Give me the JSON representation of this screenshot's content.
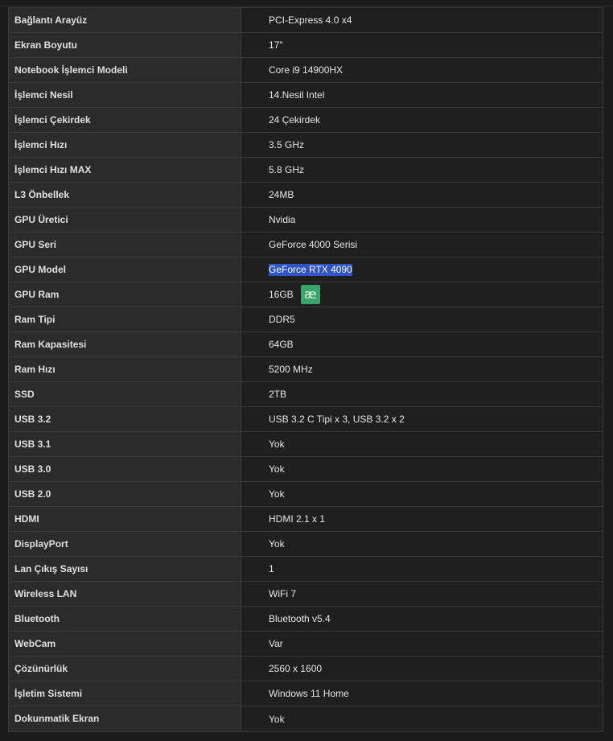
{
  "specs": [
    {
      "label": "Bağlantı Arayüz",
      "value": "PCI-Express 4.0 x4"
    },
    {
      "label": "Ekran Boyutu",
      "value": "17\""
    },
    {
      "label": "Notebook İşlemci Modeli",
      "value": "Core i9 14900HX"
    },
    {
      "label": "İşlemci Nesil",
      "value": "14.Nesil Intel"
    },
    {
      "label": "İşlemci Çekirdek",
      "value": "24 Çekirdek"
    },
    {
      "label": "İşlemci Hızı",
      "value": "3.5 GHz"
    },
    {
      "label": "İşlemci Hızı MAX",
      "value": "5.8 GHz"
    },
    {
      "label": "L3 Önbellek",
      "value": "24MB"
    },
    {
      "label": "GPU Üretici",
      "value": "Nvidia"
    },
    {
      "label": "GPU Seri",
      "value": "GeForce 4000 Serisi"
    },
    {
      "label": "GPU Model",
      "value": "GeForce RTX 4090"
    },
    {
      "label": "GPU Ram",
      "value": "16GB"
    },
    {
      "label": "Ram Tipi",
      "value": "DDR5"
    },
    {
      "label": "Ram Kapasitesi",
      "value": "64GB"
    },
    {
      "label": "Ram Hızı",
      "value": "5200 MHz"
    },
    {
      "label": "SSD",
      "value": "2TB"
    },
    {
      "label": "USB 3.2",
      "value": "USB 3.2 C Tipi x 3, USB 3.2 x 2"
    },
    {
      "label": "USB 3.1",
      "value": "Yok"
    },
    {
      "label": "USB 3.0",
      "value": "Yok"
    },
    {
      "label": "USB 2.0",
      "value": "Yok"
    },
    {
      "label": "HDMI",
      "value": "HDMI 2.1 x 1"
    },
    {
      "label": "DisplayPort",
      "value": "Yok"
    },
    {
      "label": "Lan Çıkış Sayısı",
      "value": "1"
    },
    {
      "label": "Wireless LAN",
      "value": "WiFi 7"
    },
    {
      "label": "Bluetooth",
      "value": "Bluetooth v5.4"
    },
    {
      "label": "WebCam",
      "value": "Var"
    },
    {
      "label": "Çözünürlük",
      "value": "2560 x 1600"
    },
    {
      "label": "İşletim Sistemi",
      "value": "Windows 11 Home"
    },
    {
      "label": "Dokunmatik Ekran",
      "value": "Yok"
    }
  ],
  "selected_row_index": 10,
  "extension_icon": {
    "row_index": 11,
    "icon": "translate-extension-icon",
    "glyph": "æ",
    "color": "#3aa56a"
  },
  "colors": {
    "selection": "#2f55c8",
    "label_bg": "#2b2b2b",
    "value_bg": "#1f1f1f"
  }
}
